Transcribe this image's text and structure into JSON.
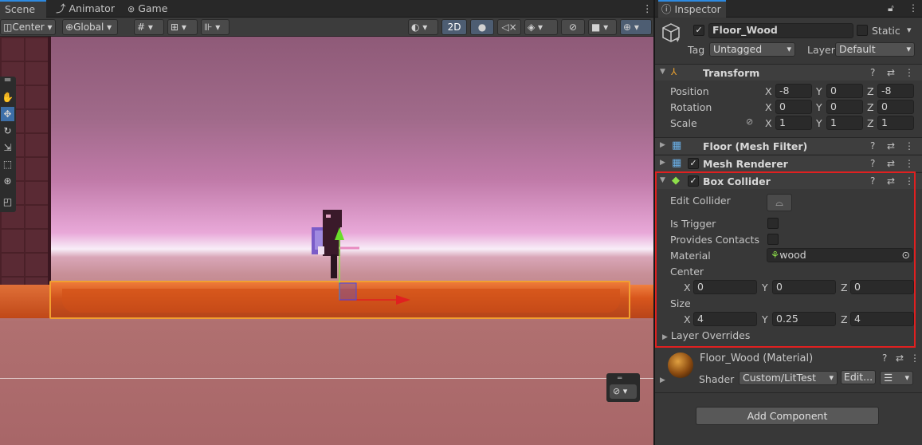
{
  "scene_tabs": [
    {
      "label": "Scene",
      "icon": "hash-icon"
    },
    {
      "label": "Animator",
      "icon": "animator-icon"
    },
    {
      "label": "Game",
      "icon": "gamepad-icon"
    }
  ],
  "scene_toolbar": {
    "pivot_mode": "Center",
    "pivot_rotation": "Global",
    "mode_2d": "2D"
  },
  "inspector": {
    "tab_label": "Inspector",
    "object_name": "Floor_Wood",
    "object_active": true,
    "static_label": "Static",
    "tag_label": "Tag",
    "tag_value": "Untagged",
    "layer_label": "Layer",
    "layer_value": "Default",
    "transform": {
      "title": "Transform",
      "position_label": "Position",
      "rotation_label": "Rotation",
      "scale_label": "Scale",
      "position": {
        "x": "-8",
        "y": "0",
        "z": "-8"
      },
      "rotation": {
        "x": "0",
        "y": "0",
        "z": "0"
      },
      "scale": {
        "x": "1",
        "y": "1",
        "z": "1"
      }
    },
    "mesh_filter": {
      "title": "Floor (Mesh Filter)"
    },
    "mesh_renderer": {
      "title": "Mesh Renderer",
      "enabled": true
    },
    "box_collider": {
      "title": "Box Collider",
      "enabled": true,
      "edit_collider_label": "Edit Collider",
      "is_trigger_label": "Is Trigger",
      "is_trigger": false,
      "provides_contacts_label": "Provides Contacts",
      "provides_contacts": false,
      "material_label": "Material",
      "material_value": "wood",
      "center_label": "Center",
      "center": {
        "x": "0",
        "y": "0",
        "z": "0"
      },
      "size_label": "Size",
      "size": {
        "x": "4",
        "y": "0.25",
        "z": "4"
      },
      "layer_overrides_label": "Layer Overrides"
    },
    "material": {
      "title": "Floor_Wood (Material)",
      "shader_label": "Shader",
      "shader_value": "Custom/LitTest",
      "edit_label": "Edit..."
    },
    "add_component_label": "Add Component"
  },
  "axis_labels": {
    "x": "X",
    "y": "Y",
    "z": "Z"
  },
  "colors": {
    "selection_outline": "#f2a030",
    "highlight_box": "#e02020",
    "active_tab_accent": "#2d8ae0"
  }
}
